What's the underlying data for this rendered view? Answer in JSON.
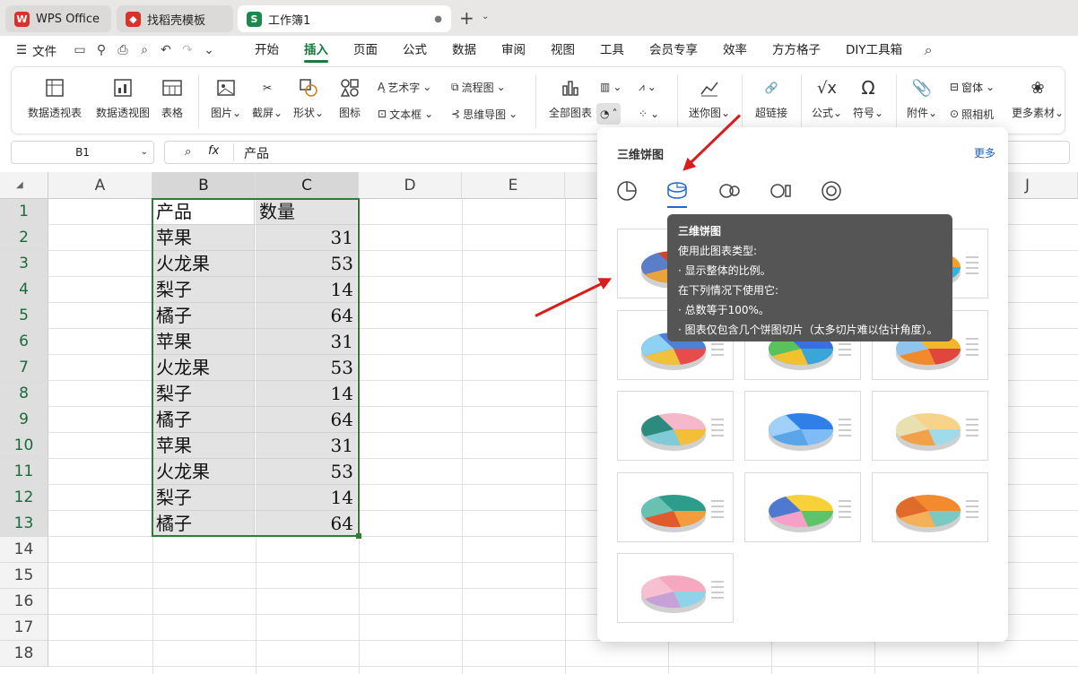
{
  "tabs": [
    {
      "label": "WPS Office",
      "logo": "W",
      "color": "#d8322b"
    },
    {
      "label": "找稻壳模板",
      "logo": "◆",
      "color": "#d8322b"
    },
    {
      "label": "工作簿1",
      "logo": "S",
      "color": "#1a8a4c"
    }
  ],
  "menus": {
    "file": "文件",
    "items": [
      "开始",
      "插入",
      "页面",
      "公式",
      "数据",
      "审阅",
      "视图",
      "工具",
      "会员专享",
      "效率",
      "方方格子",
      "DIY工具箱"
    ]
  },
  "ribbon": {
    "pivot_table": "数据透视表",
    "pivot_chart": "数据透视图",
    "table": "表格",
    "picture": "图片",
    "screenshot": "截屏",
    "shape": "形状",
    "icon": "图标",
    "wordart": "艺术字",
    "textbox": "文本框",
    "flowchart": "流程图",
    "mindmap": "思维导图",
    "all_charts": "全部图表",
    "sparkline": "迷你图",
    "hyperlink": "超链接",
    "formula": "公式",
    "symbol": "符号",
    "attachment": "附件",
    "camera": "照相机",
    "form": "窗体",
    "more_material": "更多素材"
  },
  "formula_bar": {
    "cell_ref": "B1",
    "fx": "fx",
    "content": "产品"
  },
  "columns": [
    "A",
    "B",
    "C",
    "D",
    "E",
    "J"
  ],
  "rows": [
    "1",
    "2",
    "3",
    "4",
    "5",
    "6",
    "7",
    "8",
    "9",
    "10",
    "11",
    "12",
    "13",
    "14",
    "15",
    "16",
    "17",
    "18"
  ],
  "table": {
    "header": [
      "产品",
      "数量"
    ],
    "rows": [
      [
        "苹果",
        "31"
      ],
      [
        "火龙果",
        "53"
      ],
      [
        "梨子",
        "14"
      ],
      [
        "橘子",
        "64"
      ],
      [
        "苹果",
        "31"
      ],
      [
        "火龙果",
        "53"
      ],
      [
        "梨子",
        "14"
      ],
      [
        "橘子",
        "64"
      ],
      [
        "苹果",
        "31"
      ],
      [
        "火龙果",
        "53"
      ],
      [
        "梨子",
        "14"
      ],
      [
        "橘子",
        "64"
      ]
    ]
  },
  "panel": {
    "title": "三维饼图",
    "more": "更多"
  },
  "tooltip": {
    "title": "三维饼图",
    "lines": [
      "使用此图表类型:",
      "· 显示整体的比例。",
      "在下列情况下使用它:",
      "· 总数等于100%。",
      "· 图表仅包含几个饼图切片（太多切片难以估计角度）。"
    ]
  },
  "colors": {
    "accent": "#1a7a3c",
    "selection": "#2f7d32",
    "arrow": "#d91c1c"
  }
}
